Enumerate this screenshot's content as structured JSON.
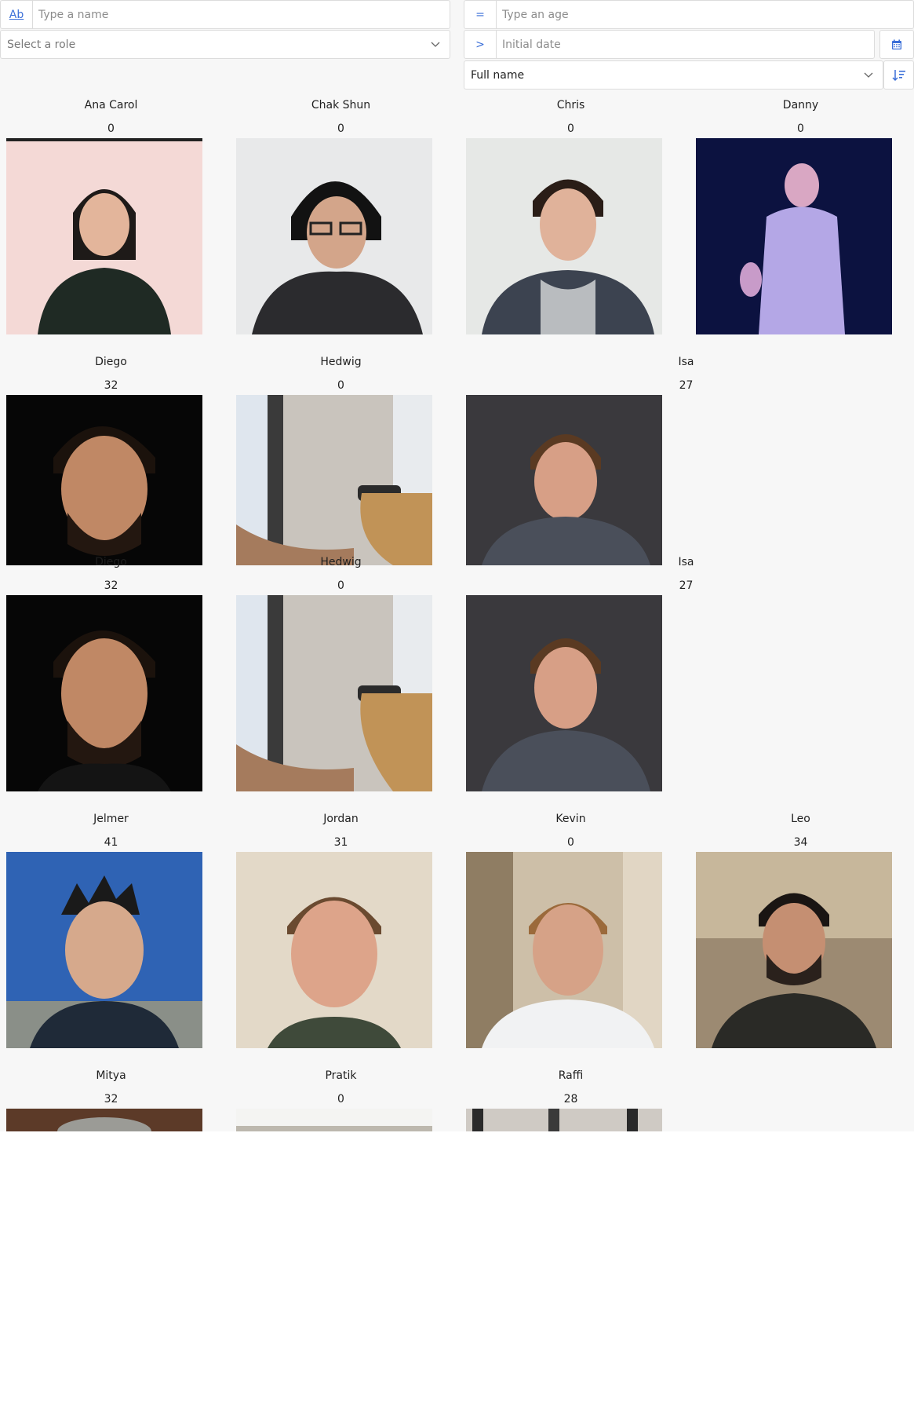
{
  "filters": {
    "name": {
      "prefix": "Ab",
      "placeholder": "Type a name"
    },
    "role": {
      "placeholder": "Select a role"
    },
    "age": {
      "prefix": "=",
      "placeholder": "Type an age"
    },
    "date": {
      "prefix": ">",
      "placeholder": "Initial date"
    },
    "sort": {
      "value": "Full name"
    }
  },
  "icons": {
    "calendar": "calendar-icon",
    "sort": "sort-descending-icon",
    "chevron": "chevron-down-icon"
  },
  "accent_color": "#3b6fd8",
  "people": [
    {
      "name": "Ana Carol",
      "age": "0"
    },
    {
      "name": "Chak Shun",
      "age": "0"
    },
    {
      "name": "Chris",
      "age": "0"
    },
    {
      "name": "Danny",
      "age": "0"
    },
    {
      "name": "Diego",
      "age": "32"
    },
    {
      "name": "Hedwig",
      "age": "0"
    },
    {
      "name": "Isa",
      "age": "27"
    },
    {
      "name": "Diego",
      "age": "32"
    },
    {
      "name": "Hedwig",
      "age": "0"
    },
    {
      "name": "Isa",
      "age": "27"
    },
    {
      "name": "Jelmer",
      "age": "41"
    },
    {
      "name": "Jordan",
      "age": "31"
    },
    {
      "name": "Kevin",
      "age": "0"
    },
    {
      "name": "Leo",
      "age": "34"
    },
    {
      "name": "Mitya",
      "age": "32"
    },
    {
      "name": "Pratik",
      "age": "0"
    },
    {
      "name": "Raffi",
      "age": "28"
    }
  ]
}
